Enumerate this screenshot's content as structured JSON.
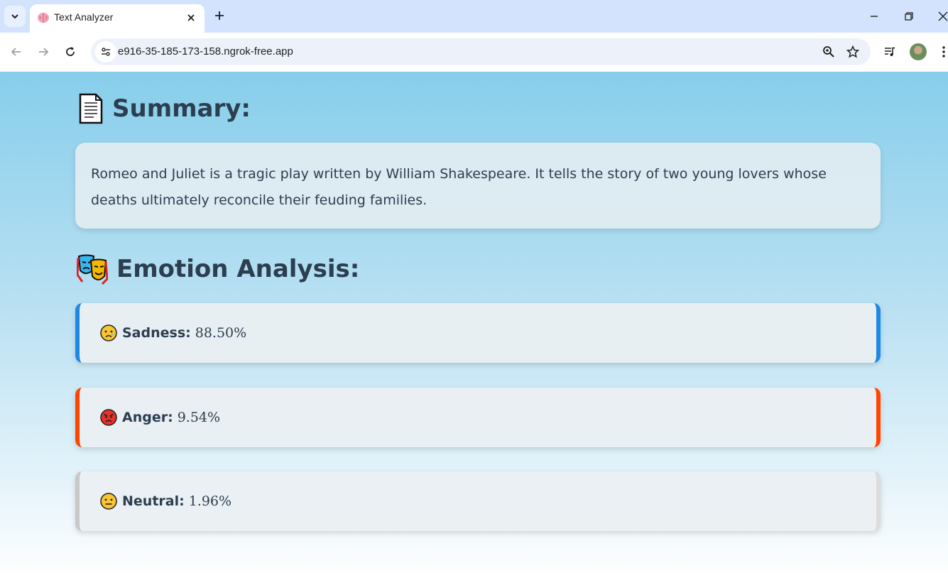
{
  "browser": {
    "tab": {
      "title": "Text Analyzer",
      "favicon": "brain-icon"
    },
    "url": "e916-35-185-173-158.ngrok-free.app"
  },
  "summary": {
    "heading": "Summary:",
    "heading_icon": "page-document-icon",
    "text": "Romeo and Juliet is a tragic play written by William Shakespeare. It tells the story of two young lovers whose deaths ultimately reconcile their feuding families."
  },
  "emotion_analysis": {
    "heading": "Emotion Analysis:",
    "heading_icon": "theater-masks-icon",
    "items": [
      {
        "label": "Sadness:",
        "value": "88.50%",
        "emoji": "crying-face-icon",
        "accent": "#1e88e5"
      },
      {
        "label": "Anger:",
        "value": "9.54%",
        "emoji": "angry-face-icon",
        "accent": "#ff4500"
      },
      {
        "label": "Neutral:",
        "value": "1.96%",
        "emoji": "neutral-face-icon",
        "accent": "#c8c8c8"
      }
    ]
  },
  "colors": {
    "heading_text": "#2c3e50",
    "page_gradient_top": "#87ceeb",
    "page_gradient_bottom": "#ffffff"
  }
}
